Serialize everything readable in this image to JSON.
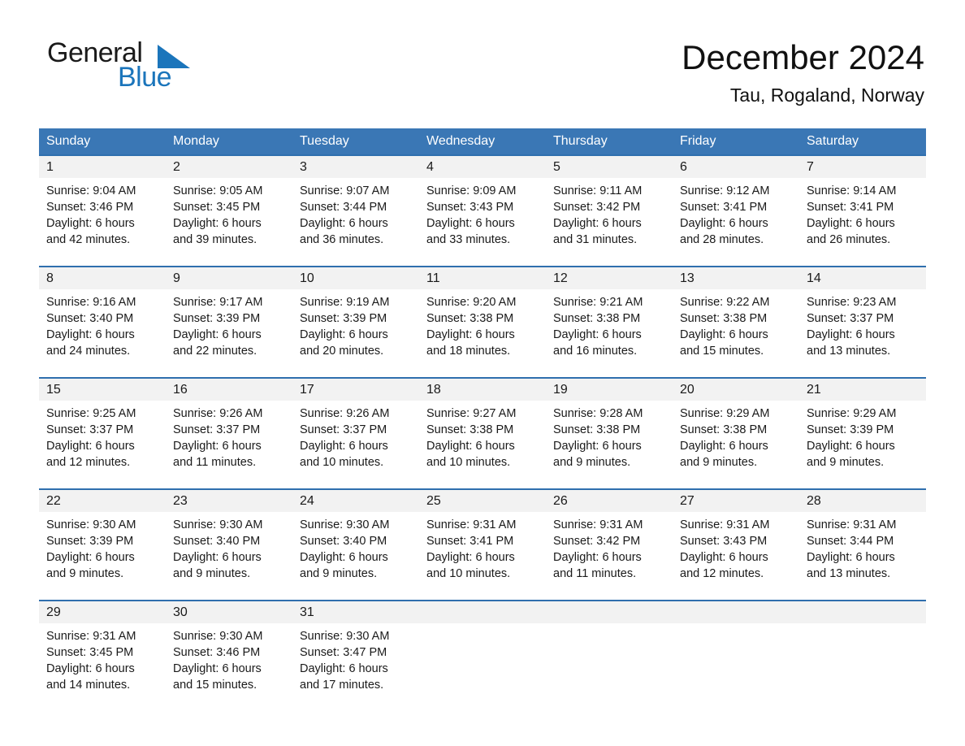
{
  "brand": {
    "name_part1": "General",
    "name_part2": "Blue",
    "accent_color": "#1b75bb"
  },
  "header": {
    "title": "December 2024",
    "subtitle": "Tau, Rogaland, Norway"
  },
  "calendar": {
    "header_bg": "#3a77b5",
    "date_band_bg": "#f2f2f2",
    "weekdays": [
      "Sunday",
      "Monday",
      "Tuesday",
      "Wednesday",
      "Thursday",
      "Friday",
      "Saturday"
    ],
    "weeks": [
      {
        "days": [
          {
            "date": "1",
            "sunrise": "Sunrise: 9:04 AM",
            "sunset": "Sunset: 3:46 PM",
            "daylight_line1": "Daylight: 6 hours",
            "daylight_line2": "and 42 minutes."
          },
          {
            "date": "2",
            "sunrise": "Sunrise: 9:05 AM",
            "sunset": "Sunset: 3:45 PM",
            "daylight_line1": "Daylight: 6 hours",
            "daylight_line2": "and 39 minutes."
          },
          {
            "date": "3",
            "sunrise": "Sunrise: 9:07 AM",
            "sunset": "Sunset: 3:44 PM",
            "daylight_line1": "Daylight: 6 hours",
            "daylight_line2": "and 36 minutes."
          },
          {
            "date": "4",
            "sunrise": "Sunrise: 9:09 AM",
            "sunset": "Sunset: 3:43 PM",
            "daylight_line1": "Daylight: 6 hours",
            "daylight_line2": "and 33 minutes."
          },
          {
            "date": "5",
            "sunrise": "Sunrise: 9:11 AM",
            "sunset": "Sunset: 3:42 PM",
            "daylight_line1": "Daylight: 6 hours",
            "daylight_line2": "and 31 minutes."
          },
          {
            "date": "6",
            "sunrise": "Sunrise: 9:12 AM",
            "sunset": "Sunset: 3:41 PM",
            "daylight_line1": "Daylight: 6 hours",
            "daylight_line2": "and 28 minutes."
          },
          {
            "date": "7",
            "sunrise": "Sunrise: 9:14 AM",
            "sunset": "Sunset: 3:41 PM",
            "daylight_line1": "Daylight: 6 hours",
            "daylight_line2": "and 26 minutes."
          }
        ]
      },
      {
        "days": [
          {
            "date": "8",
            "sunrise": "Sunrise: 9:16 AM",
            "sunset": "Sunset: 3:40 PM",
            "daylight_line1": "Daylight: 6 hours",
            "daylight_line2": "and 24 minutes."
          },
          {
            "date": "9",
            "sunrise": "Sunrise: 9:17 AM",
            "sunset": "Sunset: 3:39 PM",
            "daylight_line1": "Daylight: 6 hours",
            "daylight_line2": "and 22 minutes."
          },
          {
            "date": "10",
            "sunrise": "Sunrise: 9:19 AM",
            "sunset": "Sunset: 3:39 PM",
            "daylight_line1": "Daylight: 6 hours",
            "daylight_line2": "and 20 minutes."
          },
          {
            "date": "11",
            "sunrise": "Sunrise: 9:20 AM",
            "sunset": "Sunset: 3:38 PM",
            "daylight_line1": "Daylight: 6 hours",
            "daylight_line2": "and 18 minutes."
          },
          {
            "date": "12",
            "sunrise": "Sunrise: 9:21 AM",
            "sunset": "Sunset: 3:38 PM",
            "daylight_line1": "Daylight: 6 hours",
            "daylight_line2": "and 16 minutes."
          },
          {
            "date": "13",
            "sunrise": "Sunrise: 9:22 AM",
            "sunset": "Sunset: 3:38 PM",
            "daylight_line1": "Daylight: 6 hours",
            "daylight_line2": "and 15 minutes."
          },
          {
            "date": "14",
            "sunrise": "Sunrise: 9:23 AM",
            "sunset": "Sunset: 3:37 PM",
            "daylight_line1": "Daylight: 6 hours",
            "daylight_line2": "and 13 minutes."
          }
        ]
      },
      {
        "days": [
          {
            "date": "15",
            "sunrise": "Sunrise: 9:25 AM",
            "sunset": "Sunset: 3:37 PM",
            "daylight_line1": "Daylight: 6 hours",
            "daylight_line2": "and 12 minutes."
          },
          {
            "date": "16",
            "sunrise": "Sunrise: 9:26 AM",
            "sunset": "Sunset: 3:37 PM",
            "daylight_line1": "Daylight: 6 hours",
            "daylight_line2": "and 11 minutes."
          },
          {
            "date": "17",
            "sunrise": "Sunrise: 9:26 AM",
            "sunset": "Sunset: 3:37 PM",
            "daylight_line1": "Daylight: 6 hours",
            "daylight_line2": "and 10 minutes."
          },
          {
            "date": "18",
            "sunrise": "Sunrise: 9:27 AM",
            "sunset": "Sunset: 3:38 PM",
            "daylight_line1": "Daylight: 6 hours",
            "daylight_line2": "and 10 minutes."
          },
          {
            "date": "19",
            "sunrise": "Sunrise: 9:28 AM",
            "sunset": "Sunset: 3:38 PM",
            "daylight_line1": "Daylight: 6 hours",
            "daylight_line2": "and 9 minutes."
          },
          {
            "date": "20",
            "sunrise": "Sunrise: 9:29 AM",
            "sunset": "Sunset: 3:38 PM",
            "daylight_line1": "Daylight: 6 hours",
            "daylight_line2": "and 9 minutes."
          },
          {
            "date": "21",
            "sunrise": "Sunrise: 9:29 AM",
            "sunset": "Sunset: 3:39 PM",
            "daylight_line1": "Daylight: 6 hours",
            "daylight_line2": "and 9 minutes."
          }
        ]
      },
      {
        "days": [
          {
            "date": "22",
            "sunrise": "Sunrise: 9:30 AM",
            "sunset": "Sunset: 3:39 PM",
            "daylight_line1": "Daylight: 6 hours",
            "daylight_line2": "and 9 minutes."
          },
          {
            "date": "23",
            "sunrise": "Sunrise: 9:30 AM",
            "sunset": "Sunset: 3:40 PM",
            "daylight_line1": "Daylight: 6 hours",
            "daylight_line2": "and 9 minutes."
          },
          {
            "date": "24",
            "sunrise": "Sunrise: 9:30 AM",
            "sunset": "Sunset: 3:40 PM",
            "daylight_line1": "Daylight: 6 hours",
            "daylight_line2": "and 9 minutes."
          },
          {
            "date": "25",
            "sunrise": "Sunrise: 9:31 AM",
            "sunset": "Sunset: 3:41 PM",
            "daylight_line1": "Daylight: 6 hours",
            "daylight_line2": "and 10 minutes."
          },
          {
            "date": "26",
            "sunrise": "Sunrise: 9:31 AM",
            "sunset": "Sunset: 3:42 PM",
            "daylight_line1": "Daylight: 6 hours",
            "daylight_line2": "and 11 minutes."
          },
          {
            "date": "27",
            "sunrise": "Sunrise: 9:31 AM",
            "sunset": "Sunset: 3:43 PM",
            "daylight_line1": "Daylight: 6 hours",
            "daylight_line2": "and 12 minutes."
          },
          {
            "date": "28",
            "sunrise": "Sunrise: 9:31 AM",
            "sunset": "Sunset: 3:44 PM",
            "daylight_line1": "Daylight: 6 hours",
            "daylight_line2": "and 13 minutes."
          }
        ]
      },
      {
        "days": [
          {
            "date": "29",
            "sunrise": "Sunrise: 9:31 AM",
            "sunset": "Sunset: 3:45 PM",
            "daylight_line1": "Daylight: 6 hours",
            "daylight_line2": "and 14 minutes."
          },
          {
            "date": "30",
            "sunrise": "Sunrise: 9:30 AM",
            "sunset": "Sunset: 3:46 PM",
            "daylight_line1": "Daylight: 6 hours",
            "daylight_line2": "and 15 minutes."
          },
          {
            "date": "31",
            "sunrise": "Sunrise: 9:30 AM",
            "sunset": "Sunset: 3:47 PM",
            "daylight_line1": "Daylight: 6 hours",
            "daylight_line2": "and 17 minutes."
          },
          {
            "date": "",
            "sunrise": "",
            "sunset": "",
            "daylight_line1": "",
            "daylight_line2": ""
          },
          {
            "date": "",
            "sunrise": "",
            "sunset": "",
            "daylight_line1": "",
            "daylight_line2": ""
          },
          {
            "date": "",
            "sunrise": "",
            "sunset": "",
            "daylight_line1": "",
            "daylight_line2": ""
          },
          {
            "date": "",
            "sunrise": "",
            "sunset": "",
            "daylight_line1": "",
            "daylight_line2": ""
          }
        ]
      }
    ]
  }
}
